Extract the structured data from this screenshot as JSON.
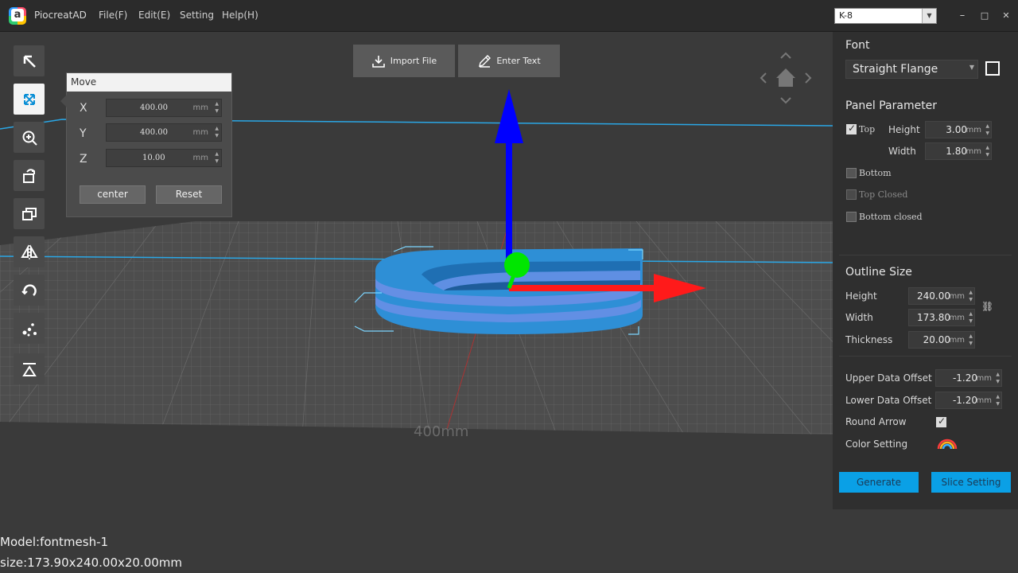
{
  "app": {
    "title": "PiocreatAD"
  },
  "menu": [
    "File(F)",
    "Edit(E)",
    "Setting",
    "Help(H)"
  ],
  "printer": {
    "selected": "K-8"
  },
  "window_controls": {
    "minimize": "–",
    "maximize": "□",
    "close": "✕"
  },
  "toolbar": {
    "items": [
      {
        "name": "select-tool",
        "icon": "arrow-up-left-icon"
      },
      {
        "name": "move-tool",
        "icon": "move-arrows-icon",
        "active": true
      },
      {
        "name": "zoom-tool",
        "icon": "zoom-in-icon"
      },
      {
        "name": "rotate-place-tool",
        "icon": "box-rotate-icon"
      },
      {
        "name": "duplicate-tool",
        "icon": "layers-icon"
      },
      {
        "name": "mirror-tool",
        "icon": "mirror-icon"
      },
      {
        "name": "rotate-tool",
        "icon": "rotate-icon"
      },
      {
        "name": "support-tool",
        "icon": "dots-icon"
      },
      {
        "name": "lay-flat-tool",
        "icon": "lay-flat-icon"
      }
    ]
  },
  "move_panel": {
    "title": "Move",
    "fields": [
      {
        "axis": "X",
        "value": "400.00",
        "unit": "mm"
      },
      {
        "axis": "Y",
        "value": "400.00",
        "unit": "mm"
      },
      {
        "axis": "Z",
        "value": "10.00",
        "unit": "mm"
      }
    ],
    "center_label": "center",
    "reset_label": "Reset"
  },
  "top_buttons": {
    "import_label": "Import File",
    "text_label": "Enter Text"
  },
  "model_info": {
    "name": "Model:fontmesh-1",
    "size": "size:173.90x240.00x20.00mm"
  },
  "right_panel": {
    "font": {
      "title": "Font",
      "selected": "Straight Flange",
      "color": "#ffffff"
    },
    "panel_parameter": {
      "title": "Panel Parameter",
      "top": {
        "label": "Top",
        "checked": true
      },
      "height": {
        "label": "Height",
        "value": "3.00",
        "unit": "mm"
      },
      "width": {
        "label": "Width",
        "value": "1.80",
        "unit": "mm"
      },
      "bottom": {
        "label": "Bottom",
        "checked": false
      },
      "top_closed": {
        "label": "Top Closed",
        "checked": false
      },
      "bottom_closed": {
        "label": "Bottom closed",
        "checked": false
      }
    },
    "outline_size": {
      "title": "Outline Size",
      "height": {
        "label": "Height",
        "value": "240.00",
        "unit": "mm"
      },
      "width": {
        "label": "Width",
        "value": "173.80",
        "unit": "mm"
      },
      "thickness": {
        "label": "Thickness",
        "value": "20.00",
        "unit": "mm"
      }
    },
    "upper_offset": {
      "label": "Upper Data Offset",
      "value": "-1.20",
      "unit": "mm"
    },
    "lower_offset": {
      "label": "Lower Data Offset",
      "value": "-1.20",
      "unit": "mm"
    },
    "round_arrow": {
      "label": "Round Arrow",
      "checked": true
    },
    "color_setting": {
      "label": "Color Setting",
      "icon": "rainbow-icon"
    },
    "generate_label": "Generate",
    "slice_label": "Slice Setting"
  },
  "colors": {
    "accent": "#0aa0e6",
    "axis_x": "#ff1a1a",
    "axis_y": "#00e600",
    "axis_z": "#0000ff",
    "model": "#2e8fd6"
  }
}
